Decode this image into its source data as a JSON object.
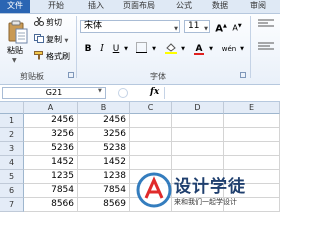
{
  "tabs": [
    "文件",
    "开始",
    "插入",
    "页面布局",
    "公式",
    "数据",
    "审阅"
  ],
  "clipboard": {
    "paste_label": "粘贴",
    "cut_label": "剪切",
    "copy_label": "复制",
    "format_painter_label": "格式刷",
    "group_label": "剪贴板"
  },
  "font": {
    "name": "宋体",
    "size": "11",
    "group_label": "字体",
    "bold": "B",
    "italic": "I",
    "underline": "U",
    "text_color_glyph": "A",
    "wen_glyph": "wén"
  },
  "formula_bar": {
    "name_box": "G21",
    "fx": "fx",
    "value": ""
  },
  "grid": {
    "columns": [
      "A",
      "B",
      "C",
      "D",
      "E"
    ],
    "rows": [
      {
        "n": "1",
        "a": "2456",
        "b": "2456"
      },
      {
        "n": "2",
        "a": "3256",
        "b": "3256"
      },
      {
        "n": "3",
        "a": "5236",
        "b": "5238"
      },
      {
        "n": "4",
        "a": "1452",
        "b": "1452"
      },
      {
        "n": "5",
        "a": "1235",
        "b": "1238"
      },
      {
        "n": "6",
        "a": "7854",
        "b": "7854"
      },
      {
        "n": "7",
        "a": "8566",
        "b": "8569"
      }
    ]
  },
  "watermark": {
    "title": "设计学徒",
    "subtitle": "来和我们一起学设计"
  },
  "colors": {
    "ribbon_bg": "#e9f0f9",
    "file_tab": "#2a65b3",
    "header_bg": "#e4ecf7",
    "watermark_ring": "#1f6fb8"
  }
}
